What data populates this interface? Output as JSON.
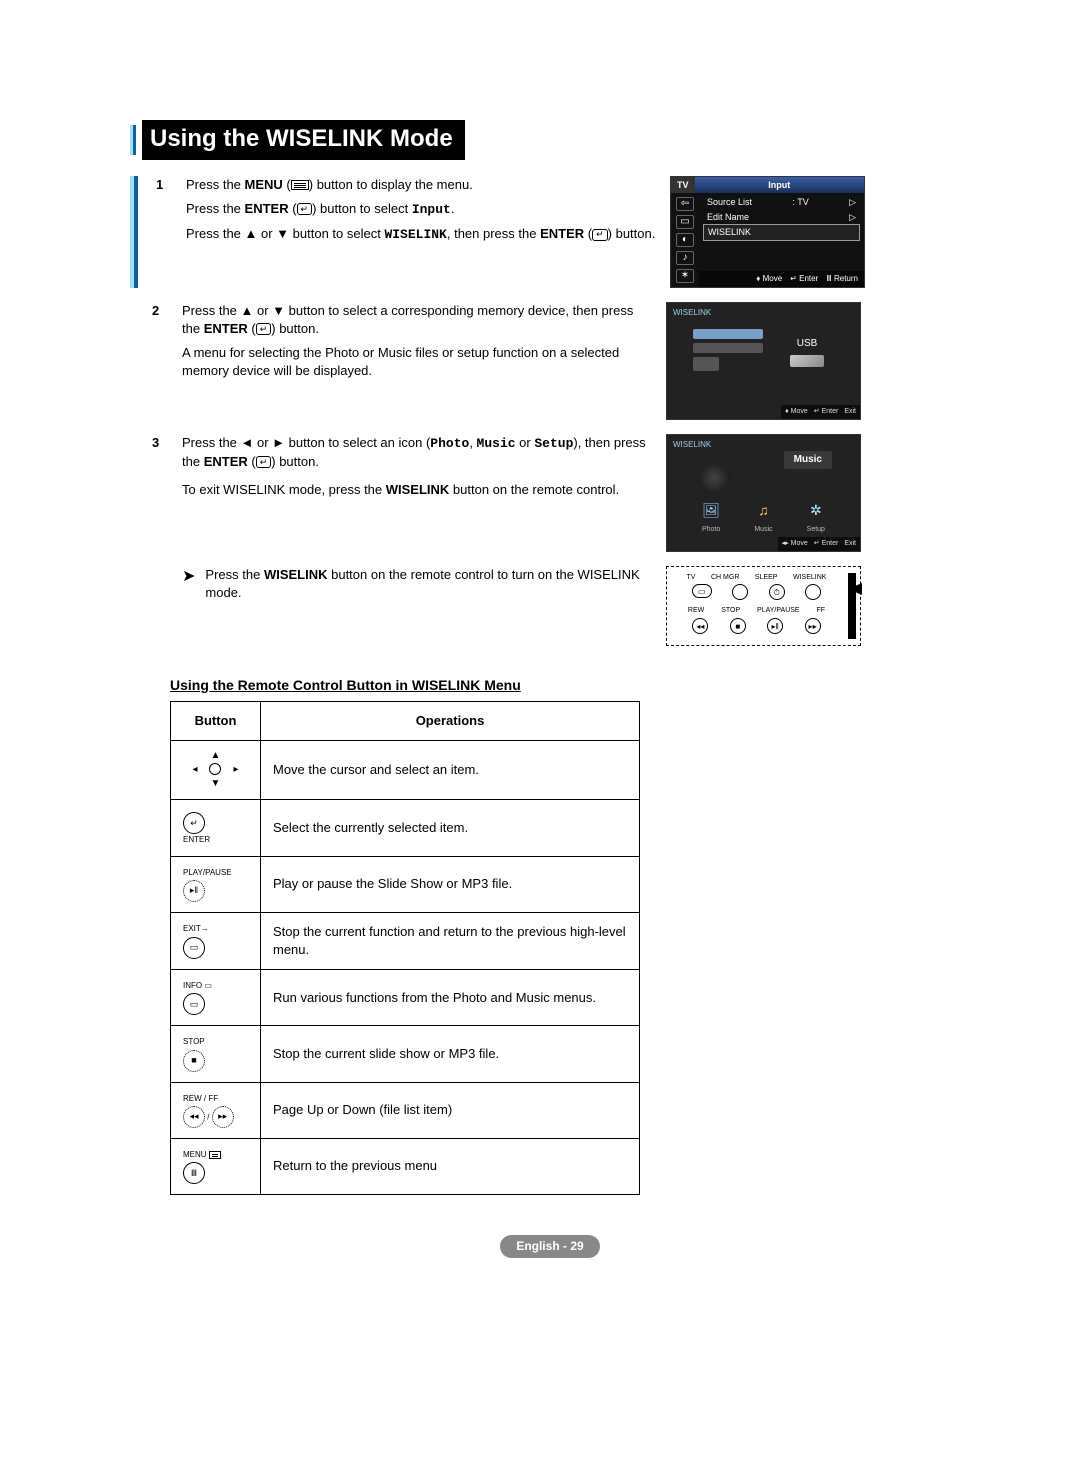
{
  "title": "Using the WISELINK Mode",
  "steps": {
    "s1": {
      "num": "1",
      "l1a": "Press the ",
      "l1b": "MENU",
      "l1c": " (",
      "l1d": ") button to display the menu.",
      "l2a": "Press the ",
      "l2b": "ENTER",
      "l2c": " (",
      "l2d": ") button to select ",
      "l2e": "Input",
      "l2f": ".",
      "l3a": "Press the ▲ or ▼ button to select ",
      "l3b": "WISELINK",
      "l3c": ", then press the ",
      "l3d": "ENTER",
      "l3e": " (",
      "l3f": ") button."
    },
    "s2": {
      "num": "2",
      "l1a": "Press the ▲ or ▼ button to select a corresponding memory device, then press the ",
      "l1b": "ENTER",
      "l1c": " (",
      "l1d": ") button.",
      "l2": "A menu for selecting the Photo or Music files or setup function on a selected memory device will be displayed."
    },
    "s3": {
      "num": "3",
      "l1a": "Press the ◄ or ► button to select an icon (",
      "l1b": "Photo",
      "l1c": ", ",
      "l1d": "Music",
      "l1e": " or ",
      "l1f": "Setup",
      "l1g": "), then press the ",
      "l1h": "ENTER",
      "l1i": " (",
      "l1j": ") button.",
      "l2a": "To exit WISELINK mode, press the ",
      "l2b": "WISELINK",
      "l2c": " button on the remote control."
    },
    "note": {
      "l1a": "Press the ",
      "l1b": "WISELINK",
      "l1c": " button on the remote control to turn on the WISELINK mode."
    }
  },
  "osd1": {
    "tv": "TV",
    "input": "Input",
    "source_list": "Source List",
    "source_val": ": TV",
    "edit_name": "Edit Name",
    "wiselink": "WISELINK",
    "move": "Move",
    "enter": "Enter",
    "return": "Return"
  },
  "osd2": {
    "brand": "WISELINK",
    "usb": "USB",
    "move": "Move",
    "enter": "Enter",
    "exit": "Exit"
  },
  "osd3": {
    "brand": "WISELINK",
    "title": "Music",
    "photo": "Photo",
    "music": "Music",
    "setup": "Setup",
    "move": "Move",
    "enter": "Enter",
    "exit": "Exit"
  },
  "remote": {
    "tv": "TV",
    "chmgr": "CH MGR",
    "sleep": "SLEEP",
    "wiselink": "WISELINK",
    "rew": "REW",
    "stop": "STOP",
    "playpause": "PLAY/PAUSE",
    "ff": "FF"
  },
  "table": {
    "heading": "Using the Remote Control Button in WISELINK Menu",
    "col1": "Button",
    "col2": "Operations",
    "rows": [
      {
        "btn_label": "",
        "op": "Move the cursor and select an item."
      },
      {
        "btn_label": "ENTER",
        "op": "Select the currently selected item."
      },
      {
        "btn_label": "PLAY/PAUSE",
        "op": "Play or pause the Slide Show or MP3 file."
      },
      {
        "btn_label": "EXIT→",
        "op": "Stop the current function and return to the previous high-level menu."
      },
      {
        "btn_label": "INFO",
        "op": "Run various functions from the Photo and Music menus."
      },
      {
        "btn_label": "STOP",
        "op": "Stop the current slide show or MP3 file."
      },
      {
        "btn_label": "REW / FF",
        "op": "Page Up or Down (file list item)"
      },
      {
        "btn_label": "MENU",
        "op": "Return to the previous menu"
      }
    ]
  },
  "footer": {
    "lang": "English - ",
    "page": "29"
  }
}
